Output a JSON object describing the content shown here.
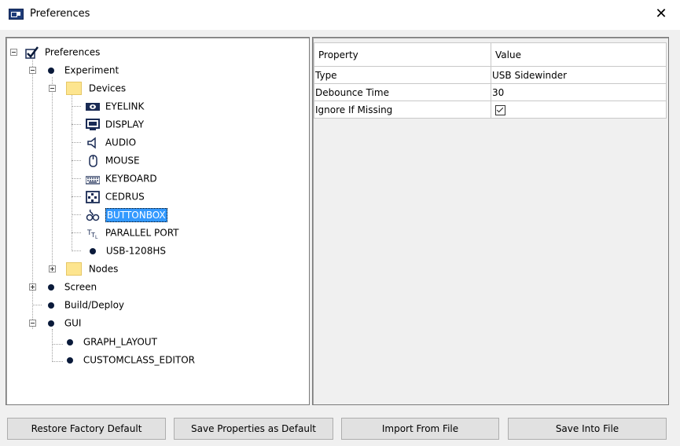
{
  "window": {
    "title": "Preferences",
    "close_glyph": "✕"
  },
  "tree": {
    "root": "Preferences",
    "experiment": "Experiment",
    "devices": "Devices",
    "device_items": [
      "EYELINK",
      "DISPLAY",
      "AUDIO",
      "MOUSE",
      "KEYBOARD",
      "CEDRUS",
      "BUTTONBOX",
      "PARALLEL PORT",
      "USB-1208HS"
    ],
    "nodes": "Nodes",
    "screen": "Screen",
    "build_deploy": "Build/Deploy",
    "gui": "GUI",
    "gui_items": [
      "GRAPH_LAYOUT",
      "CUSTOMCLASS_EDITOR"
    ],
    "selected": "BUTTONBOX"
  },
  "properties": {
    "headers": [
      "Property",
      "Value"
    ],
    "rows": [
      {
        "property": "Type",
        "value": "USB Sidewinder"
      },
      {
        "property": "Debounce Time",
        "value": "30"
      },
      {
        "property": "Ignore If Missing",
        "value_checked": true
      }
    ]
  },
  "buttons": {
    "restore": "Restore Factory Default",
    "save_default": "Save Properties as Default",
    "import": "Import From File",
    "save_file": "Save Into File"
  }
}
